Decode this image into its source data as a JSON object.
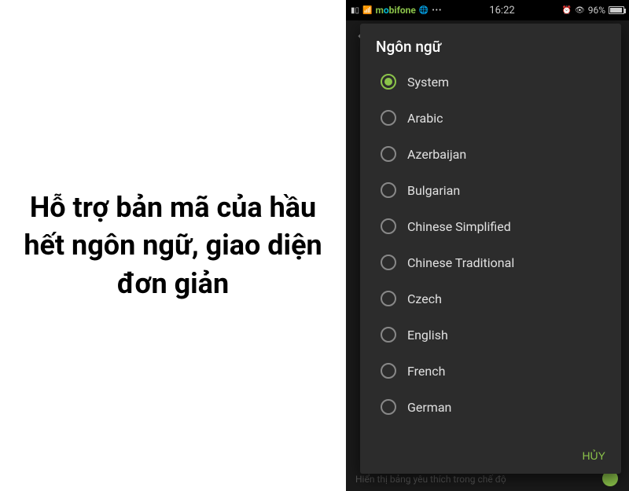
{
  "left": {
    "heading": "Hỗ trợ bản mã của hầu hết ngôn ngữ, giao diện đơn giản"
  },
  "statusbar": {
    "carrier": "mobifone",
    "time": "16:22",
    "battery": "96%"
  },
  "background": {
    "hint": "Hiển thị bảng yêu thích trong chế độ"
  },
  "dialog": {
    "title": "Ngôn ngữ",
    "cancel": "HỦY",
    "languages": [
      {
        "label": "System",
        "selected": true
      },
      {
        "label": "Arabic",
        "selected": false
      },
      {
        "label": "Azerbaijan",
        "selected": false
      },
      {
        "label": "Bulgarian",
        "selected": false
      },
      {
        "label": "Chinese Simplified",
        "selected": false
      },
      {
        "label": "Chinese Traditional",
        "selected": false
      },
      {
        "label": "Czech",
        "selected": false
      },
      {
        "label": "English",
        "selected": false
      },
      {
        "label": "French",
        "selected": false
      },
      {
        "label": "German",
        "selected": false
      }
    ]
  }
}
